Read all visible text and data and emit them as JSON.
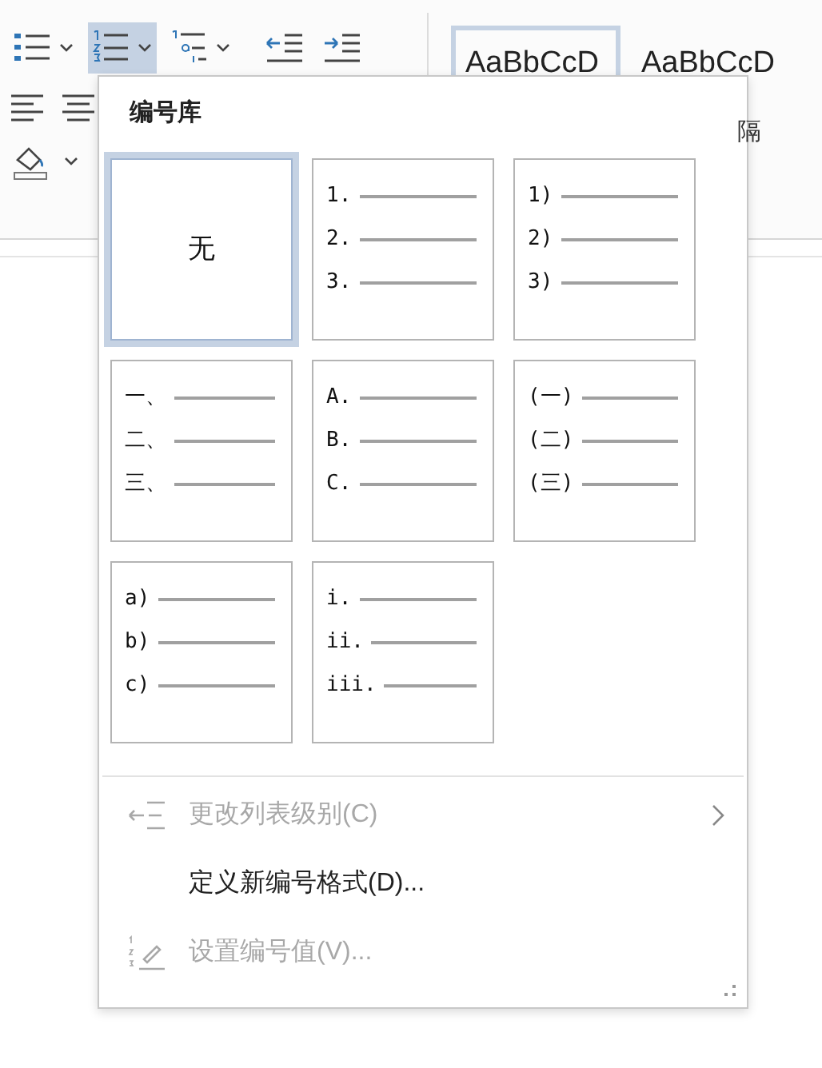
{
  "ribbon": {
    "tools": [
      {
        "kind": "bullets",
        "selected": false
      },
      {
        "kind": "numbering",
        "selected": true
      },
      {
        "kind": "multilevel",
        "selected": false
      },
      {
        "kind": "outdent",
        "selected": false
      },
      {
        "kind": "indent",
        "selected": false
      }
    ],
    "styles": [
      {
        "preview": "AaBbCcD",
        "selected": true
      },
      {
        "preview": "AaBbCcD",
        "selected": false
      }
    ],
    "style_caption": "隔"
  },
  "dropdown": {
    "title": "编号库",
    "tiles": [
      {
        "kind": "none",
        "label": "无",
        "selected": true
      },
      {
        "kind": "list",
        "markers": [
          "1.",
          "2.",
          "3."
        ],
        "selected": false
      },
      {
        "kind": "list",
        "markers": [
          "1)",
          "2)",
          "3)"
        ],
        "selected": false
      },
      {
        "kind": "list",
        "markers": [
          "一、",
          "二、",
          "三、"
        ],
        "selected": false
      },
      {
        "kind": "list",
        "markers": [
          "A.",
          "B.",
          "C."
        ],
        "selected": false
      },
      {
        "kind": "list",
        "markers": [
          "(一)",
          "(二)",
          "(三)"
        ],
        "selected": false
      },
      {
        "kind": "list",
        "markers": [
          "a)",
          "b)",
          "c)"
        ],
        "selected": false
      },
      {
        "kind": "list",
        "markers": [
          "i.",
          "ii.",
          "iii."
        ],
        "selected": false
      }
    ],
    "menu_items": [
      {
        "kind": "change-level",
        "label": "更改列表级别(C)",
        "disabled": true,
        "submenu": true
      },
      {
        "kind": "define",
        "label": "定义新编号格式(D)...",
        "disabled": false,
        "submenu": false
      },
      {
        "kind": "set-value",
        "label": "设置编号值(V)...",
        "disabled": true,
        "submenu": false
      }
    ]
  }
}
